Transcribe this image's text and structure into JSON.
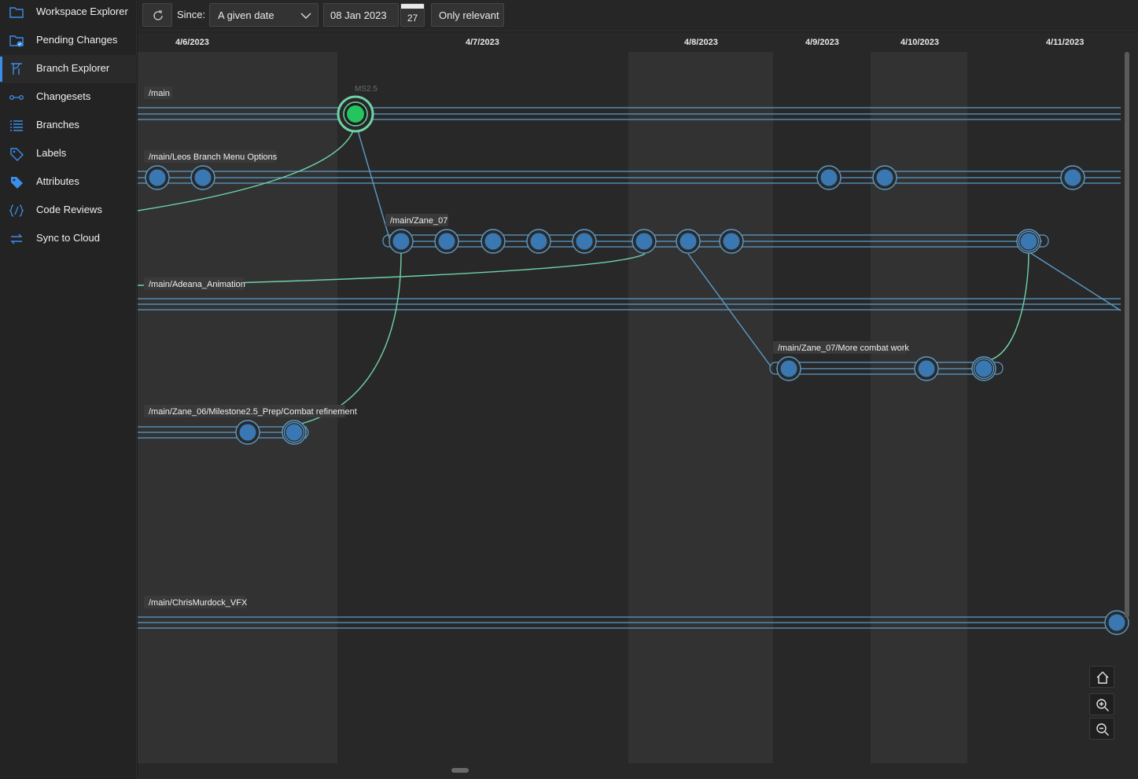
{
  "sidebar": {
    "items": [
      {
        "label": "Workspace Explorer",
        "icon": "folder-icon"
      },
      {
        "label": "Pending Changes",
        "icon": "pending-changes-icon"
      },
      {
        "label": "Branch Explorer",
        "icon": "branch-explorer-icon",
        "active": true
      },
      {
        "label": "Changesets",
        "icon": "changesets-icon"
      },
      {
        "label": "Branches",
        "icon": "branches-list-icon"
      },
      {
        "label": "Labels",
        "icon": "tag-icon"
      },
      {
        "label": "Attributes",
        "icon": "attributes-icon"
      },
      {
        "label": "Code Reviews",
        "icon": "code-review-icon"
      },
      {
        "label": "Sync to Cloud",
        "icon": "sync-icon"
      }
    ]
  },
  "toolbar": {
    "refresh_icon": "refresh-icon",
    "since_label": "Since:",
    "since_value": "A given date",
    "date_value": "08 Jan 2023",
    "calendar_day": "27",
    "only_relevant_label": "Only relevant"
  },
  "graph": {
    "dates": [
      "4/6/2023",
      "4/7/2023",
      "4/8/2023",
      "4/9/2023",
      "4/10/2023",
      "4/11/2023"
    ],
    "label_ms": "MS2.5",
    "branches": [
      "/main",
      "/main/Leos Branch Menu Options",
      "/main/Zane_07",
      "/main/Adeana_Animation",
      "/main/Zane_07/More combat work",
      "/main/Zane_06/Milestone2.5_Prep/Combat refinement",
      "/main/ChrisMurdock_VFX"
    ]
  },
  "colors": {
    "accent": "#3b8eea",
    "lane": "#5b9bc8",
    "node": "#3a78b4",
    "merge_link": "#6fd3a6",
    "current_node": "#22c55e"
  },
  "zoom": {
    "home_icon": "home-icon",
    "zoom_in_icon": "zoom-in-icon",
    "zoom_out_icon": "zoom-out-icon"
  }
}
